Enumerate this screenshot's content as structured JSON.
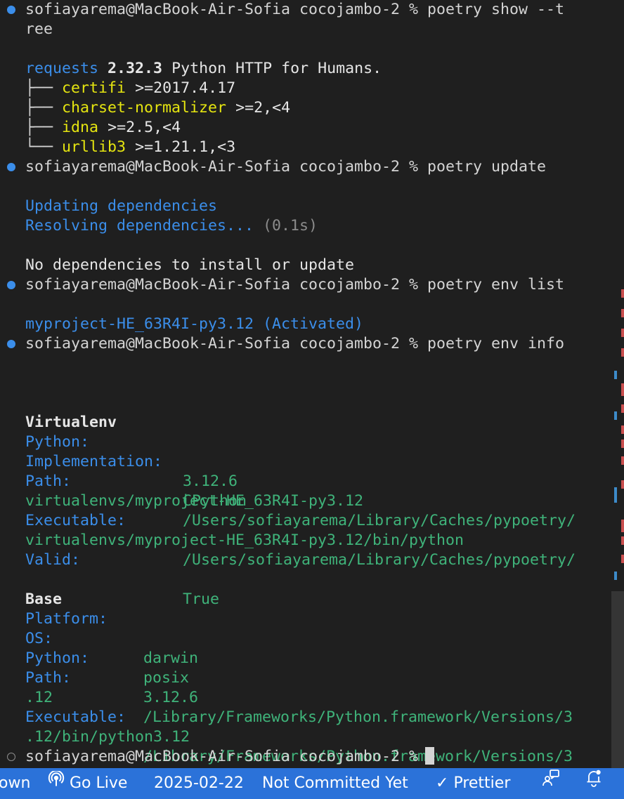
{
  "terminal": {
    "prompt": "sofiayarema@MacBook-Air-Sofia cocojambo-2 %",
    "commands": {
      "show_tree_line1": "poetry show --t",
      "show_tree_line2": "ree",
      "update": "poetry update",
      "env_list": "poetry env list",
      "env_info": "poetry env info"
    },
    "show_tree": {
      "package": "requests",
      "version": "2.32.3",
      "description": "Python HTTP for Humans.",
      "deps": [
        {
          "branch": "├──",
          "name": "certifi",
          "constraint": ">=2017.4.17"
        },
        {
          "branch": "├──",
          "name": "charset-normalizer",
          "constraint": ">=2,<4"
        },
        {
          "branch": "├──",
          "name": "idna",
          "constraint": ">=2.5,<4"
        },
        {
          "branch": "└──",
          "name": "urllib3",
          "constraint": ">=1.21.1,<3"
        }
      ]
    },
    "update_output": {
      "updating": "Updating dependencies",
      "resolving": "Resolving dependencies...",
      "resolving_time": "(0.1s)",
      "result": "No dependencies to install or update"
    },
    "env_list_output": "myproject-HE_63R4I-py3.12 (Activated)",
    "env_info_output": {
      "virtualenv_header": "Virtualenv",
      "virtualenv": {
        "python_label": "Python:",
        "python_value": "3.12.6",
        "implementation_label": "Implementation:",
        "implementation_value": "CPython",
        "path_label": "Path:",
        "path_value_line1": "/Users/sofiayarema/Library/Caches/pypoetry/",
        "path_value_line2": "virtualenvs/myproject-HE_63R4I-py3.12",
        "executable_label": "Executable:",
        "executable_value_line1": "/Users/sofiayarema/Library/Caches/pypoetry/",
        "executable_value_line2": "virtualenvs/myproject-HE_63R4I-py3.12/bin/python",
        "valid_label": "Valid:",
        "valid_value": "True"
      },
      "base_header": "Base",
      "base": {
        "platform_label": "Platform:",
        "platform_value": "darwin",
        "os_label": "OS:",
        "os_value": "posix",
        "python_label": "Python:",
        "python_value": "3.12.6",
        "path_label": "Path:",
        "path_value_line1": "/Library/Frameworks/Python.framework/Versions/3",
        "path_value_line2": ".12",
        "executable_label": "Executable:",
        "executable_value_line1": "/Library/Frameworks/Python.framework/Versions/3",
        "executable_value_line2": ".12/bin/python3.12"
      }
    }
  },
  "statusbar": {
    "left_partial": "own",
    "go_live": "Go Live",
    "date": "2025-02-22",
    "commit_status": "Not Committed Yet",
    "prettier": "Prettier",
    "prettier_check": "✓"
  },
  "colors": {
    "terminal_bg": "#1f1f1f",
    "blue": "#3b8eea",
    "yellow": "#e5e510",
    "green": "#3fb37a",
    "statusbar_bg": "#2b72d9"
  }
}
